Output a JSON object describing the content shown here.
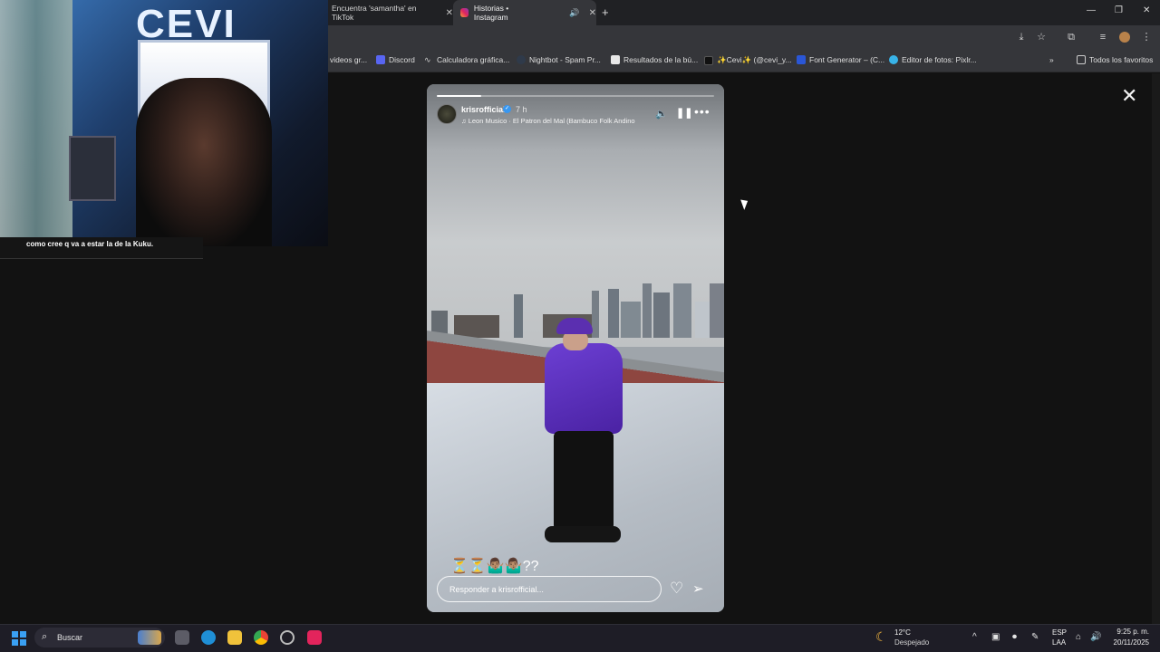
{
  "browser": {
    "tabs": [
      {
        "label": "Encuentra 'samantha' en TikTok"
      },
      {
        "label": "Historias • Instagram"
      }
    ],
    "new_tab_symbol": "+",
    "bookmarks": [
      {
        "label": "videos gr..."
      },
      {
        "label": "Discord"
      },
      {
        "label": "Calculadora gráfica..."
      },
      {
        "label": "Nightbot - Spam Pr..."
      },
      {
        "label": "Resultados de la bú..."
      },
      {
        "label": "✨Cevi✨ (@cevi_y..."
      },
      {
        "label": "Font Generator – (C..."
      },
      {
        "label": "Editor de fotos: Pixlr..."
      },
      {
        "label": "Todos los favoritos"
      }
    ]
  },
  "webcam": {
    "sign_text": "CEVI",
    "chat_message": "como cree q va a estar la de la Kuku."
  },
  "story": {
    "username": "krisrofficial",
    "time": "7 h",
    "music": "Leon Musico · El Patron del Mal (Bambuco Folk Andino",
    "emoji_row": "⏳⏳🤷🏽‍♂️🤷🏽‍♂️??",
    "reply_placeholder": "Responder a krisrofficial...",
    "progress": 0.16
  },
  "taskbar": {
    "search_label": "Buscar",
    "weather_temp": "12°C",
    "weather_desc": "Despejado",
    "lang_line1": "ESP",
    "lang_line2": "LAA",
    "time": "9:25 p. m.",
    "date": "20/11/2025"
  },
  "colors": {
    "accent": "#3aa0f3",
    "verified": "#3897f0",
    "jacket": "#5b2fb0"
  }
}
